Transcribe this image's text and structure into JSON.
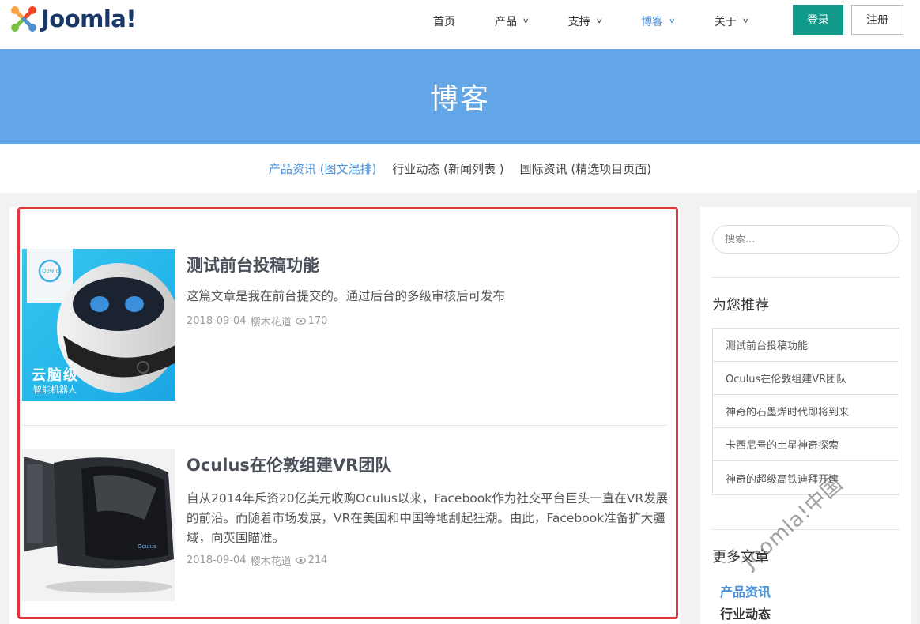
{
  "header": {
    "logo_text": "Joomla!",
    "nav": [
      {
        "label": "首页",
        "has_dropdown": false
      },
      {
        "label": "产品",
        "has_dropdown": true
      },
      {
        "label": "支持",
        "has_dropdown": true
      },
      {
        "label": "博客",
        "has_dropdown": true,
        "active": true
      },
      {
        "label": "关于",
        "has_dropdown": true
      }
    ],
    "login_label": "登录",
    "register_label": "注册"
  },
  "banner": {
    "title": "博客"
  },
  "subnav": [
    {
      "label": "产品资讯 (图文混排)",
      "active": true
    },
    {
      "label": "行业动态 (新闻列表 )",
      "active": false
    },
    {
      "label": "国际资讯 (精选项目页面)",
      "active": false
    }
  ],
  "articles": [
    {
      "title": "测试前台投稿功能",
      "intro": "这篇文章是我在前台提交的。通过后台的多级审核后可发布",
      "date": "2018-09-04",
      "author": "樱木花道",
      "views": "170",
      "thumb_caption": "云脑级",
      "thumb_subcaption": "智能机器人",
      "thumb_brand": "Qowid"
    },
    {
      "title": "Oculus在伦敦组建VR团队",
      "intro": "自从2014年斥资20亿美元收购Oculus以来，Facebook作为社交平台巨头一直在VR发展的前沿。而随着市场发展，VR在美国和中国等地刮起狂潮。由此，Facebook准备扩大疆域，向英国瞄准。",
      "date": "2018-09-04",
      "author": "樱木花道",
      "views": "214",
      "thumb_brand": "Oculus"
    }
  ],
  "sidebar": {
    "search_placeholder": "搜索...",
    "recommend_heading": "为您推荐",
    "recommend_items": [
      "测试前台投稿功能",
      "Oculus在伦敦组建VR团队",
      "神奇的石墨烯时代即将到来",
      "卡西尼号的土星神奇探索",
      "神奇的超级高铁迪拜开建"
    ],
    "more_heading": "更多文章",
    "categories": [
      {
        "label": "产品资讯",
        "color": "#4a90d9"
      },
      {
        "label": "行业动态",
        "color": "#333333"
      }
    ]
  },
  "watermark": "Joomla!中国",
  "colors": {
    "banner": "#62a6e8",
    "accent": "#4a90d9",
    "login_button": "#0f9a8a",
    "highlight_border": "#e0353a"
  }
}
